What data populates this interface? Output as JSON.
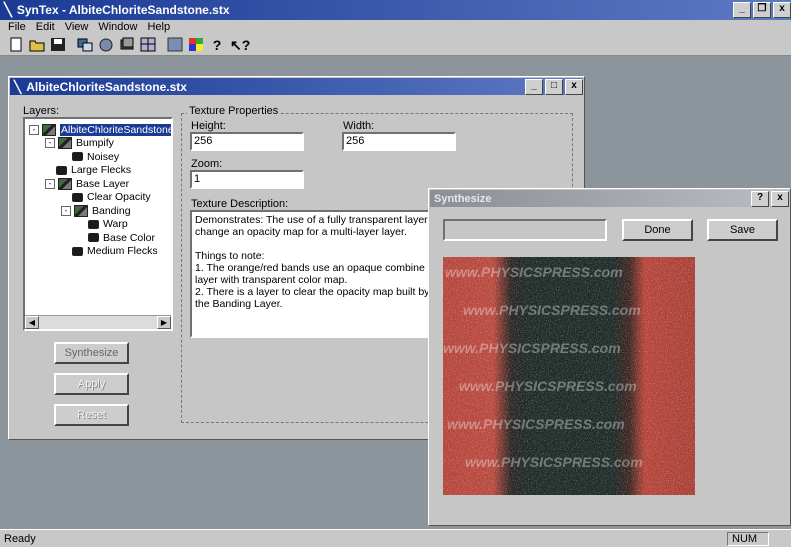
{
  "app": {
    "title": "SynTex - AlbiteChloriteSandstone.stx",
    "menu": [
      "File",
      "Edit",
      "View",
      "Window",
      "Help"
    ],
    "status": "Ready",
    "status_num": "NUM"
  },
  "doc": {
    "title": "AlbiteChloriteSandstone.stx",
    "layers_label": "Layers:",
    "tree": [
      {
        "label": "AlbiteChloriteSandstone",
        "level": 0,
        "expander": "-",
        "icon": "layer",
        "selected": true
      },
      {
        "label": "Bumpify",
        "level": 1,
        "expander": "-",
        "icon": "layer"
      },
      {
        "label": "Noisey",
        "level": 2,
        "expander": "",
        "icon": "leaf"
      },
      {
        "label": "Large Flecks",
        "level": 1,
        "expander": "",
        "icon": "leaf"
      },
      {
        "label": "Base Layer",
        "level": 1,
        "expander": "-",
        "icon": "layer"
      },
      {
        "label": "Clear Opacity",
        "level": 2,
        "expander": "",
        "icon": "leaf"
      },
      {
        "label": "Banding",
        "level": 2,
        "expander": "-",
        "icon": "layer"
      },
      {
        "label": "Warp",
        "level": 3,
        "expander": "",
        "icon": "leaf"
      },
      {
        "label": "Base Color",
        "level": 3,
        "expander": "",
        "icon": "leaf"
      },
      {
        "label": "Medium Flecks",
        "level": 2,
        "expander": "",
        "icon": "leaf"
      }
    ],
    "buttons": {
      "synthesize": "Synthesize",
      "apply": "Apply",
      "reset": "Reset"
    },
    "texture_props_label": "Texture Properties",
    "height_label": "Height:",
    "height_value": "256",
    "width_label": "Width:",
    "width_value": "256",
    "zoom_label": "Zoom:",
    "zoom_value": "1",
    "desc_label": "Texture Description:",
    "desc_lines": [
      "Demonstrates: The use of a fully transparent layer t",
      "change an opacity map for a multi-layer layer.",
      "",
      "Things to note:",
      "1. The orange/red bands use an opaque combine",
      "layer with transparent color map.",
      "2. There is a layer to clear the opacity map built by",
      "the Banding Layer."
    ]
  },
  "synth": {
    "title": "Synthesize",
    "done_label": "Done",
    "save_label": "Save",
    "help_glyph": "?",
    "close_glyph": "x",
    "watermark": "www.PHYSICSPRESS.com"
  },
  "colors": {
    "title_active": "#1a3a94",
    "band_red": "#b5443a",
    "band_dark": "#1d2a26"
  }
}
